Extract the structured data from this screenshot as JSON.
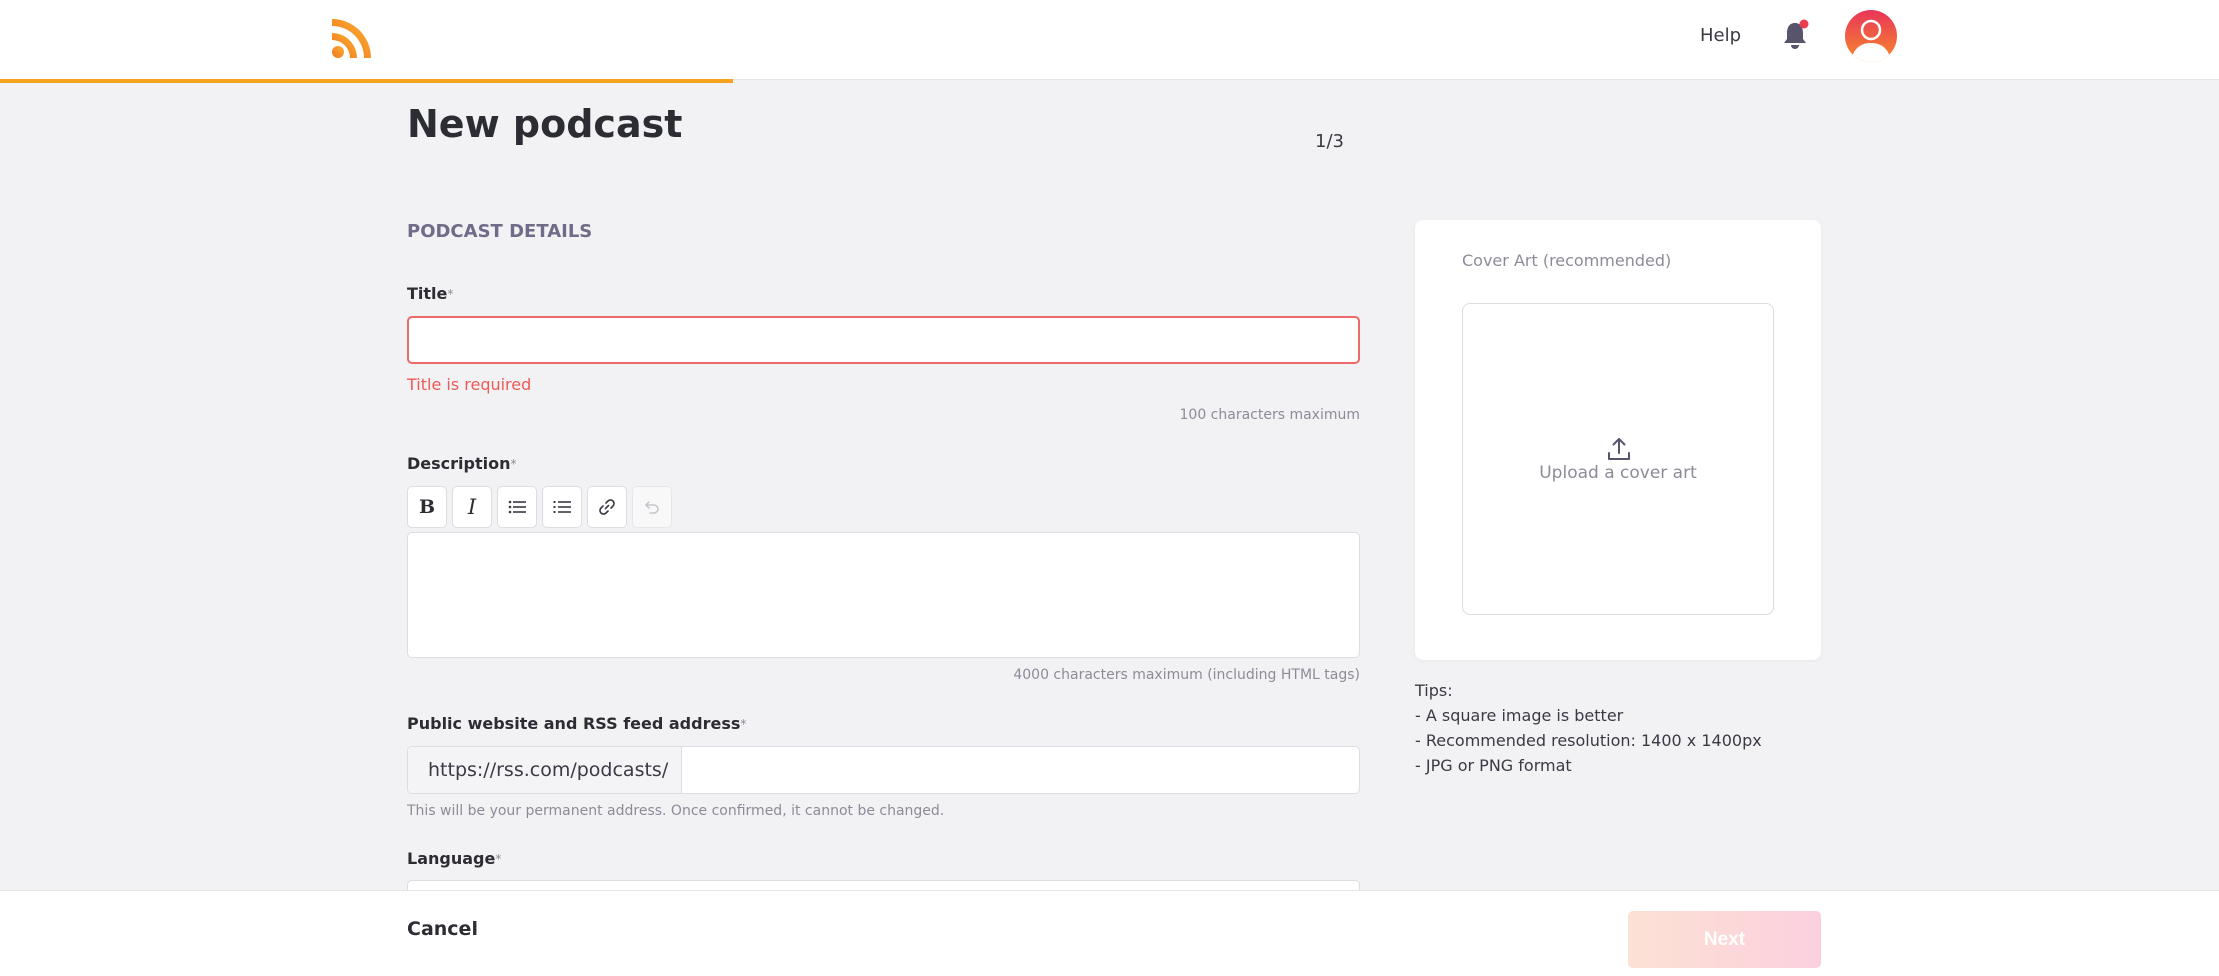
{
  "header": {
    "help_label": "Help"
  },
  "page": {
    "title": "New podcast",
    "step": "1/3",
    "section_title": "PODCAST DETAILS"
  },
  "form": {
    "title_label": "Title",
    "required_mark": "*",
    "title_value": "",
    "title_error": "Title is required",
    "title_hint": "100 characters maximum",
    "description_label": "Description",
    "description_hint": "4000 characters maximum (including HTML tags)",
    "url_label": "Public website and RSS feed address",
    "url_prefix": "https://rss.com/podcasts/",
    "url_value": "",
    "url_hint": "This will be your permanent address. Once confirmed, it cannot be changed.",
    "language_label": "Language"
  },
  "toolbar": {
    "bold": "B",
    "italic": "I",
    "icons": [
      "bold-icon",
      "italic-icon",
      "bullet-list-icon",
      "numbered-list-icon",
      "link-icon",
      "undo-icon"
    ]
  },
  "cover": {
    "label": "Cover Art (recommended)",
    "upload_text": "Upload a cover art"
  },
  "tips": {
    "heading": "Tips:",
    "items": [
      "- A square image is better",
      "- Recommended resolution: 1400 x 1400px",
      "- JPG or PNG format"
    ]
  },
  "footer": {
    "cancel_label": "Cancel",
    "next_label": "Next"
  },
  "colors": {
    "accent": "#f5a31e",
    "error": "#ec5a56",
    "section": "#6f6b88"
  }
}
